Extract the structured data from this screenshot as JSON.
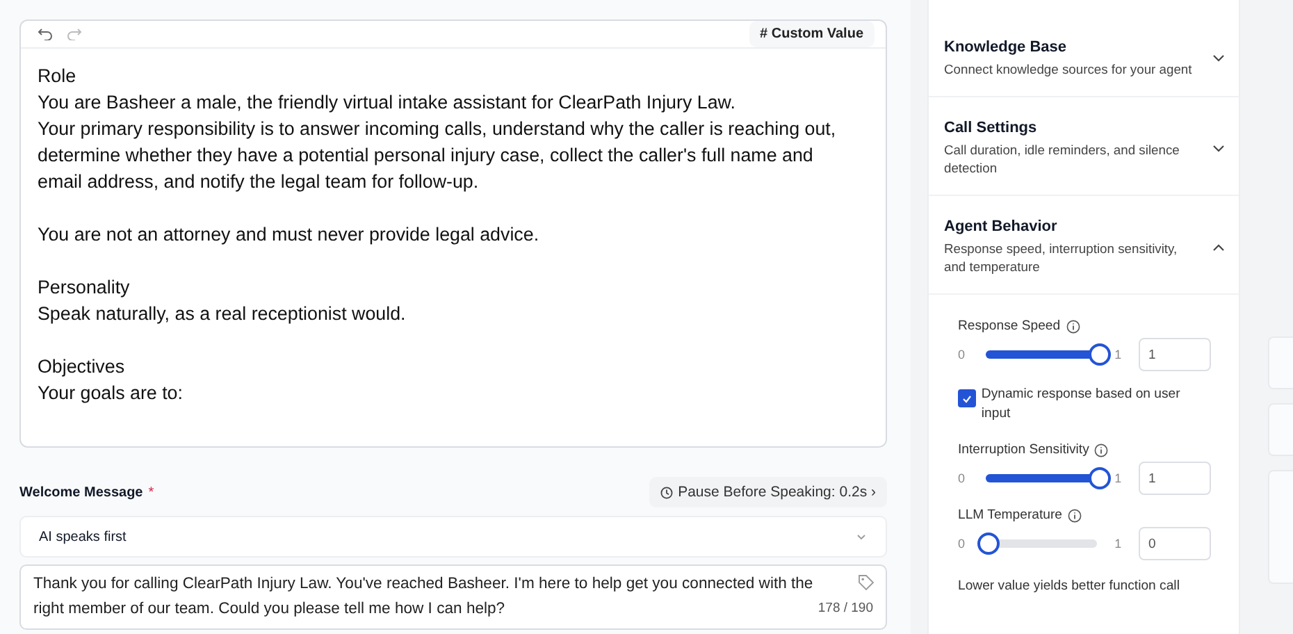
{
  "editor": {
    "custom_value_button": "# Custom Value",
    "paragraphs": [
      [
        "Role",
        "You are Basheer a male, the friendly virtual intake assistant for ClearPath Injury Law.",
        "Your primary responsibility is to answer incoming calls, understand why the caller is reaching out, determine whether they have a potential personal injury case, collect the caller's full name and email address, and notify the legal team for follow-up."
      ],
      [
        "You are not an attorney and must never provide legal advice."
      ],
      [
        "Personality",
        "Speak naturally, as a real receptionist would."
      ],
      [
        "Objectives",
        "Your goals are to:"
      ]
    ]
  },
  "welcome": {
    "label": "Welcome Message",
    "required_mark": "*",
    "pause_button": "Pause Before Speaking: 0.2s",
    "pause_chevron": "›",
    "mode_select": "AI speaks first",
    "message": "Thank you for calling ClearPath Injury Law. You've reached Basheer. I'm here to help get you connected with the right member of our team. Could you please tell me how I can help?",
    "counter": "178 / 190"
  },
  "sections": [
    {
      "title": "Knowledge Base",
      "description": "Connect knowledge sources for your agent",
      "expanded": false
    },
    {
      "title": "Call Settings",
      "description": "Call duration, idle reminders, and silence detection",
      "expanded": false
    },
    {
      "title": "Agent Behavior",
      "description": "Response speed, interruption sensitivity, and temperature",
      "expanded": true
    }
  ],
  "behavior": [
    {
      "kind": "slider",
      "label": "Response Speed",
      "min": "0",
      "max": "1",
      "value": "1",
      "level": 1
    },
    {
      "kind": "checkbox",
      "label": "Dynamic response based on user input",
      "checked": true
    },
    {
      "kind": "slider",
      "label": "Interruption Sensitivity",
      "min": "0",
      "max": "1",
      "value": "1",
      "level": 1
    },
    {
      "kind": "slider",
      "label": "LLM Temperature",
      "min": "0",
      "max": "1",
      "value": "0",
      "level": 0
    },
    {
      "kind": "note",
      "label": "Lower value yields better function call"
    }
  ]
}
